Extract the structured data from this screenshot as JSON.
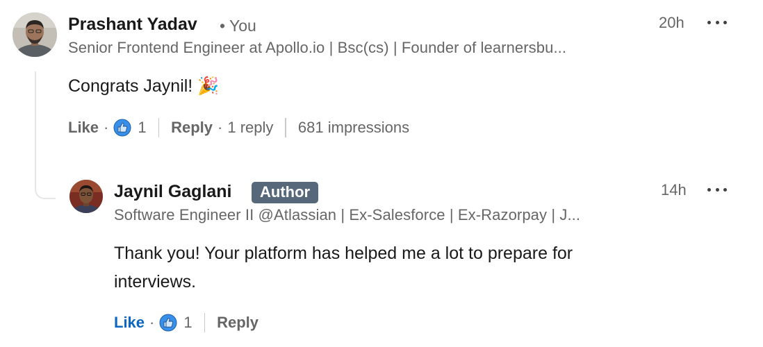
{
  "comment": {
    "author_name": "Prashant Yadav",
    "you_label": "• You",
    "headline": "Senior Frontend Engineer at Apollo.io | Bsc(cs) | Founder of learnersbu...",
    "time": "20h",
    "text": "Congrats Jaynil! 🎉",
    "actions": {
      "like_label": "Like",
      "reaction_count": "1",
      "reply_label": "Reply",
      "reply_count": "1 reply",
      "impressions": "681 impressions"
    }
  },
  "reply": {
    "author_name": "Jaynil Gaglani",
    "badge": "Author",
    "headline": "Software Engineer II @Atlassian | Ex-Salesforce | Ex-Razorpay | J...",
    "time": "14h",
    "text_line1": "Thank you! Your platform has helped me a lot to prepare for",
    "text_line2": "interviews.",
    "actions": {
      "like_label": "Like",
      "reaction_count": "1",
      "reply_label": "Reply"
    }
  },
  "icons": {
    "reaction": "like-reaction-icon",
    "more": "more-options-icon"
  },
  "colors": {
    "liked_blue": "#0a66c2",
    "author_badge_bg": "#56687a",
    "muted_text": "#666666"
  }
}
